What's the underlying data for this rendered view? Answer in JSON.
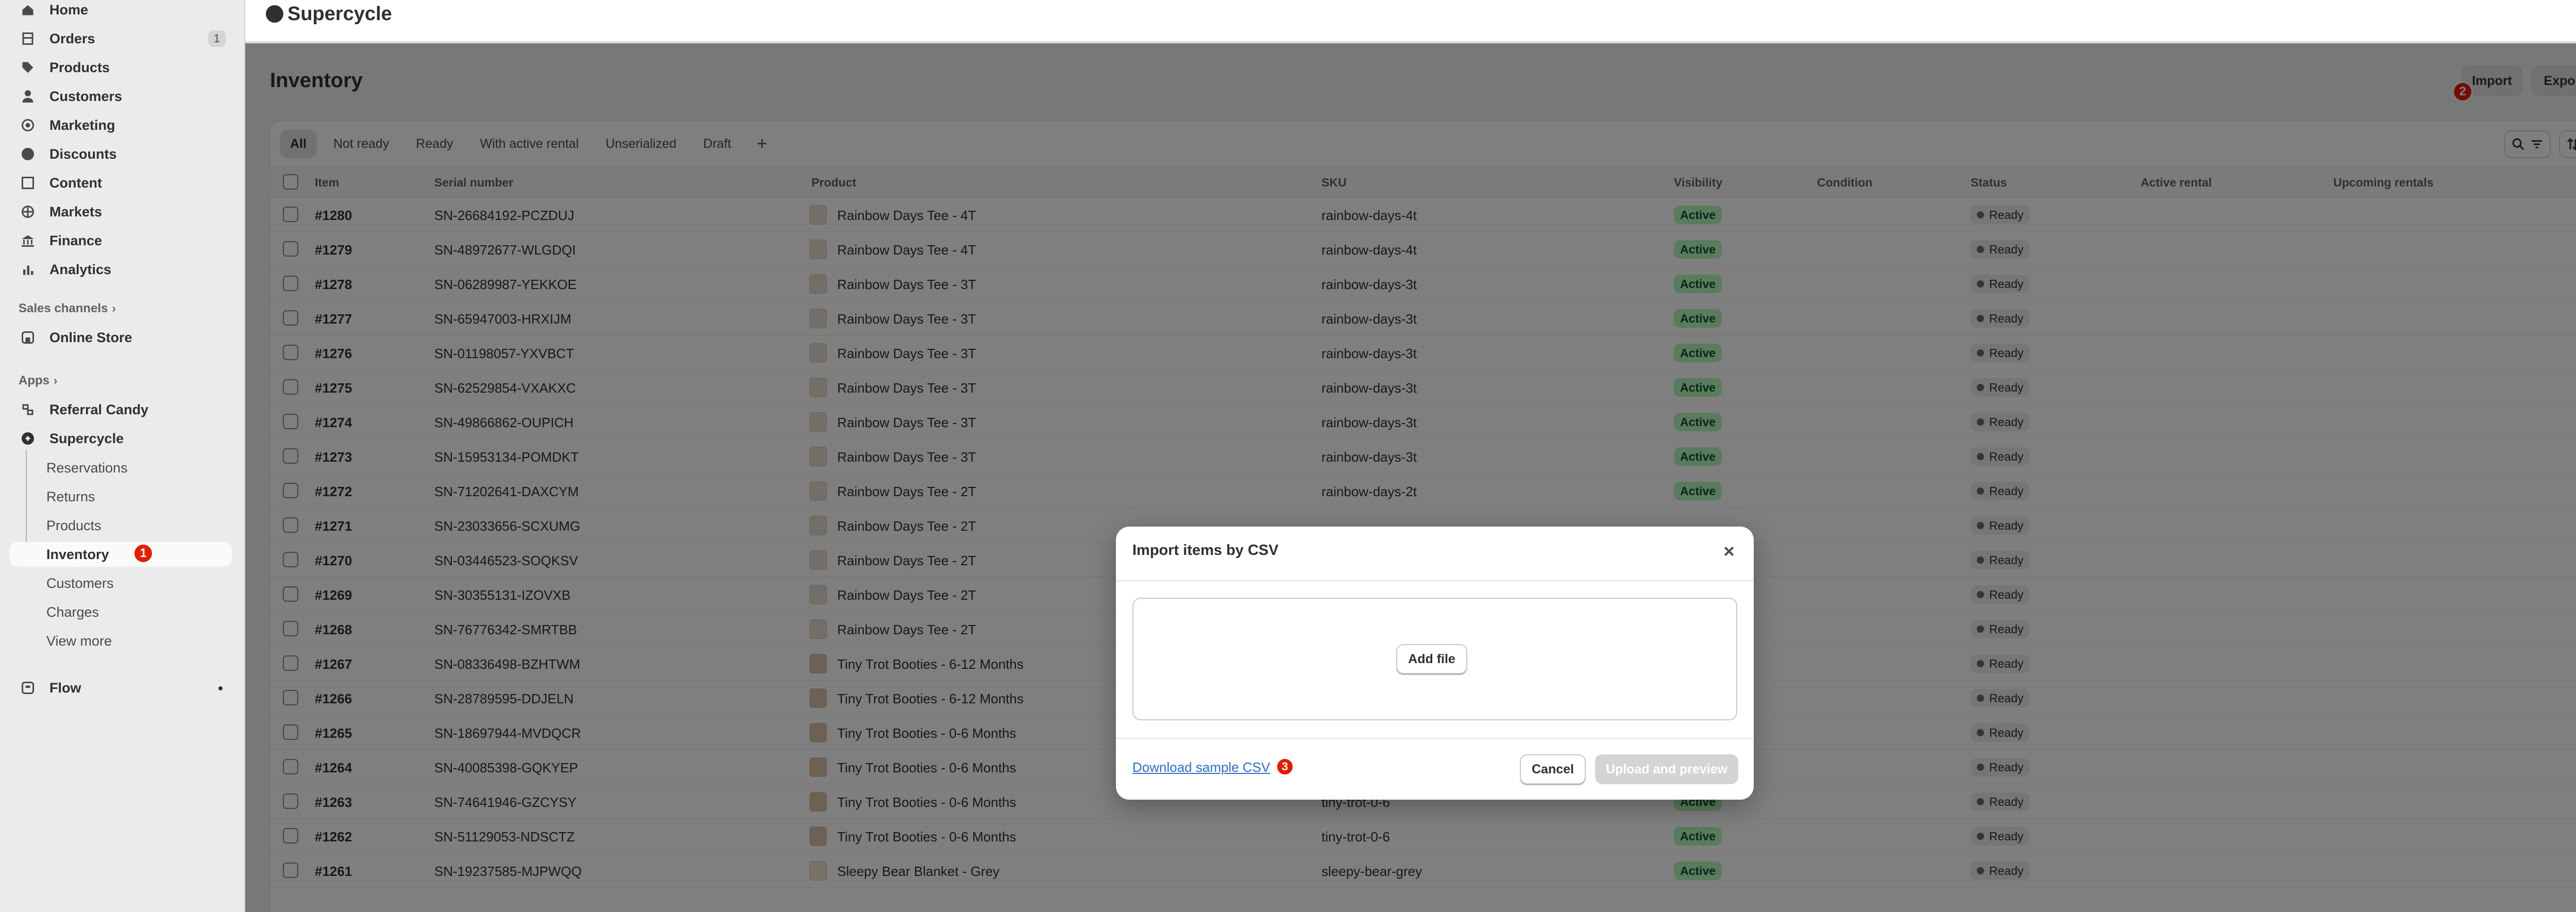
{
  "app": {
    "title": "Supercycle"
  },
  "sidebar": {
    "nav": [
      {
        "label": "Home",
        "icon": "home-icon"
      },
      {
        "label": "Orders",
        "icon": "orders-icon",
        "count": "1"
      },
      {
        "label": "Products",
        "icon": "tag-icon"
      },
      {
        "label": "Customers",
        "icon": "person-icon"
      },
      {
        "label": "Marketing",
        "icon": "target-icon"
      },
      {
        "label": "Discounts",
        "icon": "discount-icon"
      },
      {
        "label": "Content",
        "icon": "content-icon"
      },
      {
        "label": "Markets",
        "icon": "globe-icon"
      },
      {
        "label": "Finance",
        "icon": "bank-icon"
      },
      {
        "label": "Analytics",
        "icon": "bar-chart-icon"
      }
    ],
    "sales_channels_label": "Sales channels",
    "online_store_label": "Online Store",
    "apps_label": "Apps",
    "referral_candy_label": "Referral Candy",
    "supercycle_label": "Supercycle",
    "supercycle_sub": [
      "Reservations",
      "Returns",
      "Products",
      "Inventory",
      "Customers",
      "Charges",
      "View more"
    ],
    "inventory_badge": "1",
    "flow_label": "Flow"
  },
  "header": {
    "title": "Inventory",
    "import_label": "Import",
    "export_label": "Export",
    "import_badge": "2"
  },
  "tabs": [
    "All",
    "Not ready",
    "Ready",
    "With active rental",
    "Unserialized",
    "Draft",
    "+"
  ],
  "table": {
    "columns": [
      "Item",
      "Serial number",
      "Product",
      "SKU",
      "Visibility",
      "Condition",
      "Status",
      "Active rental",
      "Upcoming rentals"
    ],
    "rows": [
      {
        "item": "#1280",
        "serial": "SN-26684192-PCZDUJ",
        "product": "Rainbow Days Tee - 4T",
        "sku": "rainbow-days-4t",
        "visibility": "Active",
        "status": "Ready"
      },
      {
        "item": "#1279",
        "serial": "SN-48972677-WLGDQI",
        "product": "Rainbow Days Tee - 4T",
        "sku": "rainbow-days-4t",
        "visibility": "Active",
        "status": "Ready"
      },
      {
        "item": "#1278",
        "serial": "SN-06289987-YEKKOE",
        "product": "Rainbow Days Tee - 3T",
        "sku": "rainbow-days-3t",
        "visibility": "Active",
        "status": "Ready"
      },
      {
        "item": "#1277",
        "serial": "SN-65947003-HRXIJM",
        "product": "Rainbow Days Tee - 3T",
        "sku": "rainbow-days-3t",
        "visibility": "Active",
        "status": "Ready"
      },
      {
        "item": "#1276",
        "serial": "SN-01198057-YXVBCT",
        "product": "Rainbow Days Tee - 3T",
        "sku": "rainbow-days-3t",
        "visibility": "Active",
        "status": "Ready"
      },
      {
        "item": "#1275",
        "serial": "SN-62529854-VXAKXC",
        "product": "Rainbow Days Tee - 3T",
        "sku": "rainbow-days-3t",
        "visibility": "Active",
        "status": "Ready"
      },
      {
        "item": "#1274",
        "serial": "SN-49866862-OUPICH",
        "product": "Rainbow Days Tee - 3T",
        "sku": "rainbow-days-3t",
        "visibility": "Active",
        "status": "Ready"
      },
      {
        "item": "#1273",
        "serial": "SN-15953134-POMDKT",
        "product": "Rainbow Days Tee - 3T",
        "sku": "rainbow-days-3t",
        "visibility": "Active",
        "status": "Ready"
      },
      {
        "item": "#1272",
        "serial": "SN-71202641-DAXCYM",
        "product": "Rainbow Days Tee - 2T",
        "sku": "rainbow-days-2t",
        "visibility": "Active",
        "status": "Ready"
      },
      {
        "item": "#1271",
        "serial": "SN-23033656-SCXUMG",
        "product": "Rainbow Days Tee - 2T",
        "sku": "",
        "visibility": "",
        "status": "Ready"
      },
      {
        "item": "#1270",
        "serial": "SN-03446523-SOQKSV",
        "product": "Rainbow Days Tee - 2T",
        "sku": "",
        "visibility": "",
        "status": "Ready"
      },
      {
        "item": "#1269",
        "serial": "SN-30355131-IZOVXB",
        "product": "Rainbow Days Tee - 2T",
        "sku": "",
        "visibility": "",
        "status": "Ready"
      },
      {
        "item": "#1268",
        "serial": "SN-76776342-SMRTBB",
        "product": "Rainbow Days Tee - 2T",
        "sku": "",
        "visibility": "",
        "status": "Ready"
      },
      {
        "item": "#1267",
        "serial": "SN-08336498-BZHTWM",
        "product": "Tiny Trot Booties - 6-12 Months",
        "sku": "",
        "visibility": "",
        "status": "Ready"
      },
      {
        "item": "#1266",
        "serial": "SN-28789595-DDJELN",
        "product": "Tiny Trot Booties - 6-12 Months",
        "sku": "",
        "visibility": "",
        "status": "Ready"
      },
      {
        "item": "#1265",
        "serial": "SN-18697944-MVDQCR",
        "product": "Tiny Trot Booties - 0-6 Months",
        "sku": "",
        "visibility": "",
        "status": "Ready"
      },
      {
        "item": "#1264",
        "serial": "SN-40085398-GQKYEP",
        "product": "Tiny Trot Booties - 0-6 Months",
        "sku": "",
        "visibility": "",
        "status": "Ready"
      },
      {
        "item": "#1263",
        "serial": "SN-74641946-GZCYSY",
        "product": "Tiny Trot Booties - 0-6 Months",
        "sku": "tiny-trot-0-6",
        "visibility": "Active",
        "status": "Ready"
      },
      {
        "item": "#1262",
        "serial": "SN-51129053-NDSCTZ",
        "product": "Tiny Trot Booties - 0-6 Months",
        "sku": "tiny-trot-0-6",
        "visibility": "Active",
        "status": "Ready"
      },
      {
        "item": "#1261",
        "serial": "SN-19237585-MJPWQQ",
        "product": "Sleepy Bear Blanket - Grey",
        "sku": "sleepy-bear-grey",
        "visibility": "Active",
        "status": "Ready"
      }
    ]
  },
  "modal": {
    "title": "Import items by CSV",
    "add_file_label": "Add file",
    "download_link": "Download sample CSV",
    "download_badge": "3",
    "cancel_label": "Cancel",
    "upload_label": "Upload and preview"
  },
  "colors": {
    "accent_badge": "#e51c00",
    "active_pill": "#b4f7b8",
    "link": "#2c6ecb"
  }
}
